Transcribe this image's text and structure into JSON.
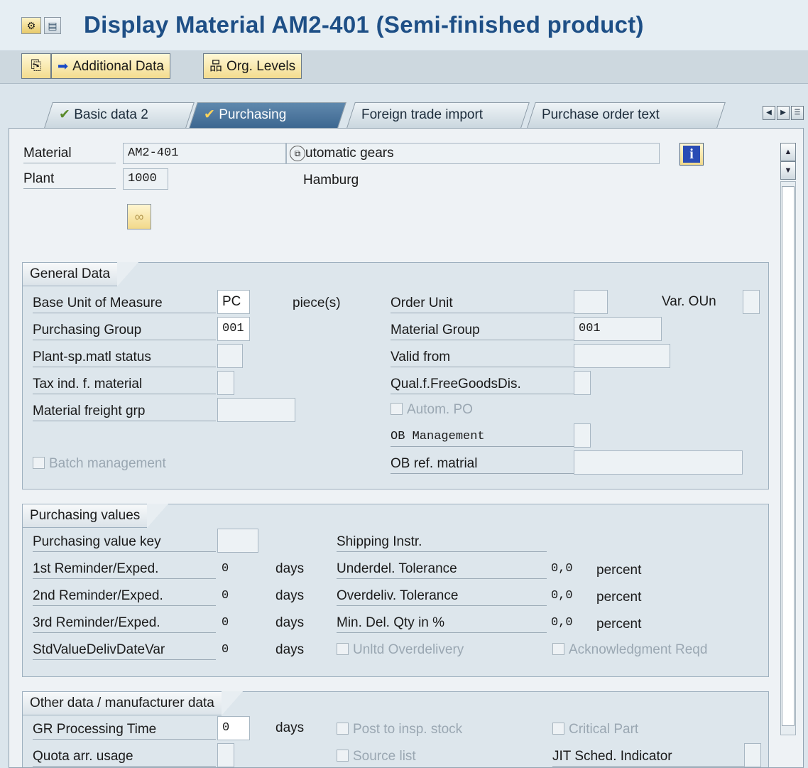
{
  "title": "Display Material AM2-401 (Semi-finished product)",
  "title_icons": [
    "display-toggle-icon",
    "document-icon"
  ],
  "toolbar": {
    "additional_data": "Additional Data",
    "org_levels": "Org. Levels"
  },
  "tabs": [
    {
      "label": "Basic data 2",
      "icon": "check-icon"
    },
    {
      "label": "Purchasing",
      "icon": "check-icon",
      "active": true
    },
    {
      "label": "Foreign trade import"
    },
    {
      "label": "Purchase order text"
    }
  ],
  "header": {
    "material_label": "Material",
    "material_value": "AM2-401",
    "material_desc": "utomatic gears",
    "plant_label": "Plant",
    "plant_value": "1000",
    "plant_name": "Hamburg"
  },
  "general": {
    "title": "General Data",
    "base_uom_label": "Base Unit of Measure",
    "base_uom_value": "PC",
    "base_uom_text": "piece(s)",
    "purch_group_label": "Purchasing Group",
    "purch_group_value": "001",
    "plant_status_label": "Plant-sp.matl status",
    "tax_ind_label": "Tax ind. f. material",
    "freight_grp_label": "Material freight grp",
    "batch_mgmt_label": "Batch management",
    "order_unit_label": "Order Unit",
    "var_oun_label": "Var. OUn",
    "mat_group_label": "Material Group",
    "mat_group_value": "001",
    "valid_from_label": "Valid from",
    "qual_label": "Qual.f.FreeGoodsDis.",
    "autom_po_label": "Autom. PO",
    "ob_mgmt_label": "OB Management",
    "ob_ref_label": "OB ref. matrial"
  },
  "purchasing": {
    "title": "Purchasing values",
    "value_key_label": "Purchasing value key",
    "reminders": [
      {
        "label": "1st Reminder/Exped.",
        "value": "0",
        "unit": "days"
      },
      {
        "label": "2nd Reminder/Exped.",
        "value": "0",
        "unit": "days"
      },
      {
        "label": "3rd Reminder/Exped.",
        "value": "0",
        "unit": "days"
      },
      {
        "label": "StdValueDelivDateVar",
        "value": "0",
        "unit": "days"
      }
    ],
    "shipping_label": "Shipping Instr.",
    "tolerances": [
      {
        "label": "Underdel. Tolerance",
        "value": "0,0",
        "unit": "percent"
      },
      {
        "label": "Overdeliv. Tolerance",
        "value": "0,0",
        "unit": "percent"
      },
      {
        "label": "Min. Del. Qty in %",
        "value": "0,0",
        "unit": "percent"
      }
    ],
    "unltd_label": "Unltd Overdelivery",
    "ack_label": "Acknowledgment Reqd"
  },
  "other": {
    "title": "Other data / manufacturer data",
    "gr_time_label": "GR Processing Time",
    "gr_time_value": "0",
    "gr_time_unit": "days",
    "quota_label": "Quota arr. usage",
    "post_insp_label": "Post to insp. stock",
    "source_list_label": "Source list",
    "critical_label": "Critical Part",
    "jit_label": "JIT Sched. Indicator"
  }
}
